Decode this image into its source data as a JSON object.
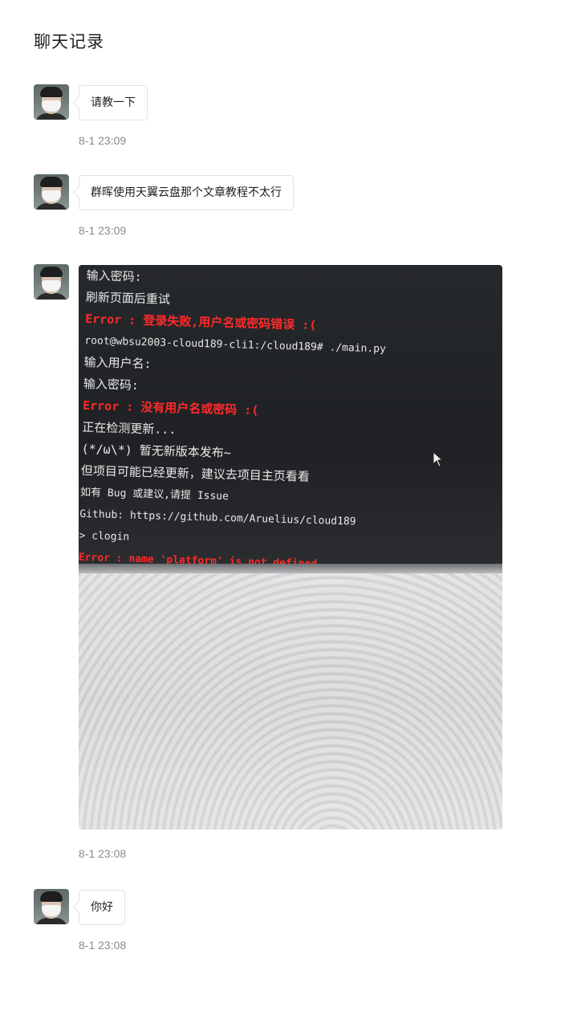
{
  "page": {
    "title": "聊天记录"
  },
  "messages": [
    {
      "type": "text",
      "text": "请教一下",
      "time": "8-1 23:09"
    },
    {
      "type": "text",
      "text": "群晖使用天翼云盘那个文章教程不太行",
      "time": "8-1 23:09"
    },
    {
      "type": "image",
      "time": "8-1 23:08",
      "image_content": {
        "terminal_lines": [
          {
            "text": "输入密码:",
            "kind": "normal"
          },
          {
            "text": "刷新页面后重试",
            "kind": "normal"
          },
          {
            "text": "Error : 登录失败,用户名或密码错误 :(",
            "kind": "error"
          },
          {
            "text": "root@wbsu2003-cloud189-cli1:/cloud189# ./main.py",
            "kind": "normal"
          },
          {
            "text": "输入用户名:",
            "kind": "normal"
          },
          {
            "text": "输入密码:",
            "kind": "normal"
          },
          {
            "text": "Error : 没有用户名或密码 :(",
            "kind": "error"
          },
          {
            "text": "正在检测更新...",
            "kind": "normal"
          },
          {
            "text": "(*/ω\\*) 暂无新版本发布~",
            "kind": "normal"
          },
          {
            "text": "但项目可能已经更新，建议去项目主页看看",
            "kind": "normal"
          },
          {
            "text": "如有 Bug 或建议,请提 Issue",
            "kind": "normal"
          },
          {
            "text": "Github: https://github.com/Aruelius/cloud189",
            "kind": "normal"
          },
          {
            "text": "> clogin",
            "kind": "normal"
          },
          {
            "text": "Error : name 'platform' is not defined",
            "kind": "error"
          },
          {
            "text": ">",
            "kind": "normal"
          }
        ]
      }
    },
    {
      "type": "text",
      "text": "你好",
      "time": "8-1 23:08"
    }
  ],
  "colors": {
    "error_red": "#ff2a2a",
    "time_gray": "#8a8a8a",
    "bubble_border": "#e3e3e3"
  }
}
